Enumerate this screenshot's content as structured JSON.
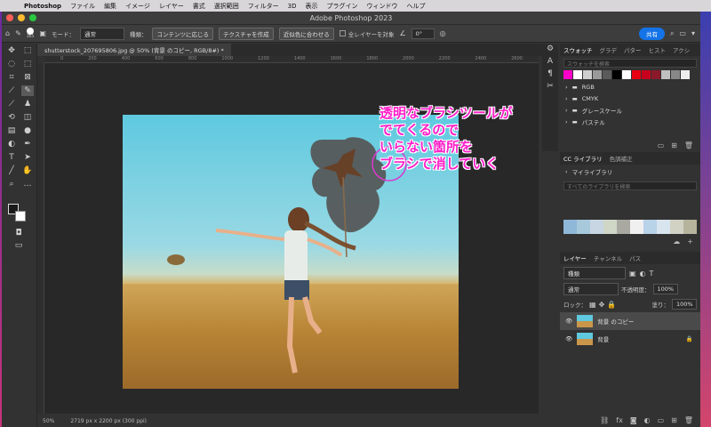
{
  "menubar": {
    "items": [
      "Photoshop",
      "ファイル",
      "編集",
      "イメージ",
      "レイヤー",
      "書式",
      "選択範囲",
      "フィルター",
      "3D",
      "表示",
      "プラグイン",
      "ウィンドウ",
      "ヘルプ"
    ]
  },
  "window": {
    "title": "Adobe Photoshop 2023"
  },
  "options": {
    "brush_size": "365",
    "mode_label": "モード：",
    "mode_value": "通常",
    "type_label": "種類：",
    "content_aware": "コンテンツに応じる",
    "create_texture": "テクスチャを作成",
    "proximity_match": "近似色に合わせる",
    "all_layers": "全レイヤーを対象",
    "angle": "0°",
    "share": "共有"
  },
  "document": {
    "tab": "shutterstock_207695806.jpg @ 50% (背景 のコピー, RGB/8#) *",
    "ruler_marks": [
      "0",
      "200",
      "400",
      "600",
      "800",
      "1000",
      "1200",
      "1400",
      "1600",
      "1800",
      "2000",
      "2200",
      "2400",
      "2600"
    ]
  },
  "overlay": {
    "lines": [
      "透明なブラシツールが",
      "でてくるので",
      "いらない箇所を",
      "ブラシで消していく"
    ],
    "color": "#ff1ec8"
  },
  "status": {
    "zoom": "50%",
    "size": "2719 px x 2200 px (300 ppi)"
  },
  "swatches_panel": {
    "tabs": [
      "スウォッチ",
      "グラデ",
      "パター",
      "ヒスト",
      "アクシ"
    ],
    "search_placeholder": "スウォッチを検索",
    "colors": [
      "#ff00c8",
      "#ffffff",
      "#cfcfcf",
      "#9a9a9a",
      "#5a5a5a",
      "#000000",
      "#ffffff",
      "#e60012",
      "#c8001e",
      "#8a1a2a",
      "#c0c0c0",
      "#888888",
      "#eeeeee"
    ],
    "folders": [
      "RGB",
      "CMYK",
      "グレースケール",
      "パステル"
    ]
  },
  "libraries_panel": {
    "tabs": [
      "CC ライブラリ",
      "色調補正"
    ],
    "library": "マイライブラリ",
    "search_placeholder": "すべてのライブラリを検索",
    "colors": [
      "#8fb7d8",
      "#a8c8dc",
      "#c7d6e2",
      "#cfd6c6",
      "#a9a9a2",
      "#f0f0f0",
      "#b8d2e8",
      "#d8e4ee",
      "#d1d2c4",
      "#b6b49c"
    ]
  },
  "layers_panel": {
    "tabs": [
      "レイヤー",
      "チャンネル",
      "パス"
    ],
    "kind": "種類",
    "blend_mode": "通常",
    "opacity_label": "不透明度：",
    "opacity": "100%",
    "lock_label": "ロック：",
    "fill_label": "塗り：",
    "fill": "100%",
    "layers": [
      {
        "name": "背景 のコピー",
        "selected": true
      },
      {
        "name": "背景",
        "selected": false
      }
    ]
  }
}
